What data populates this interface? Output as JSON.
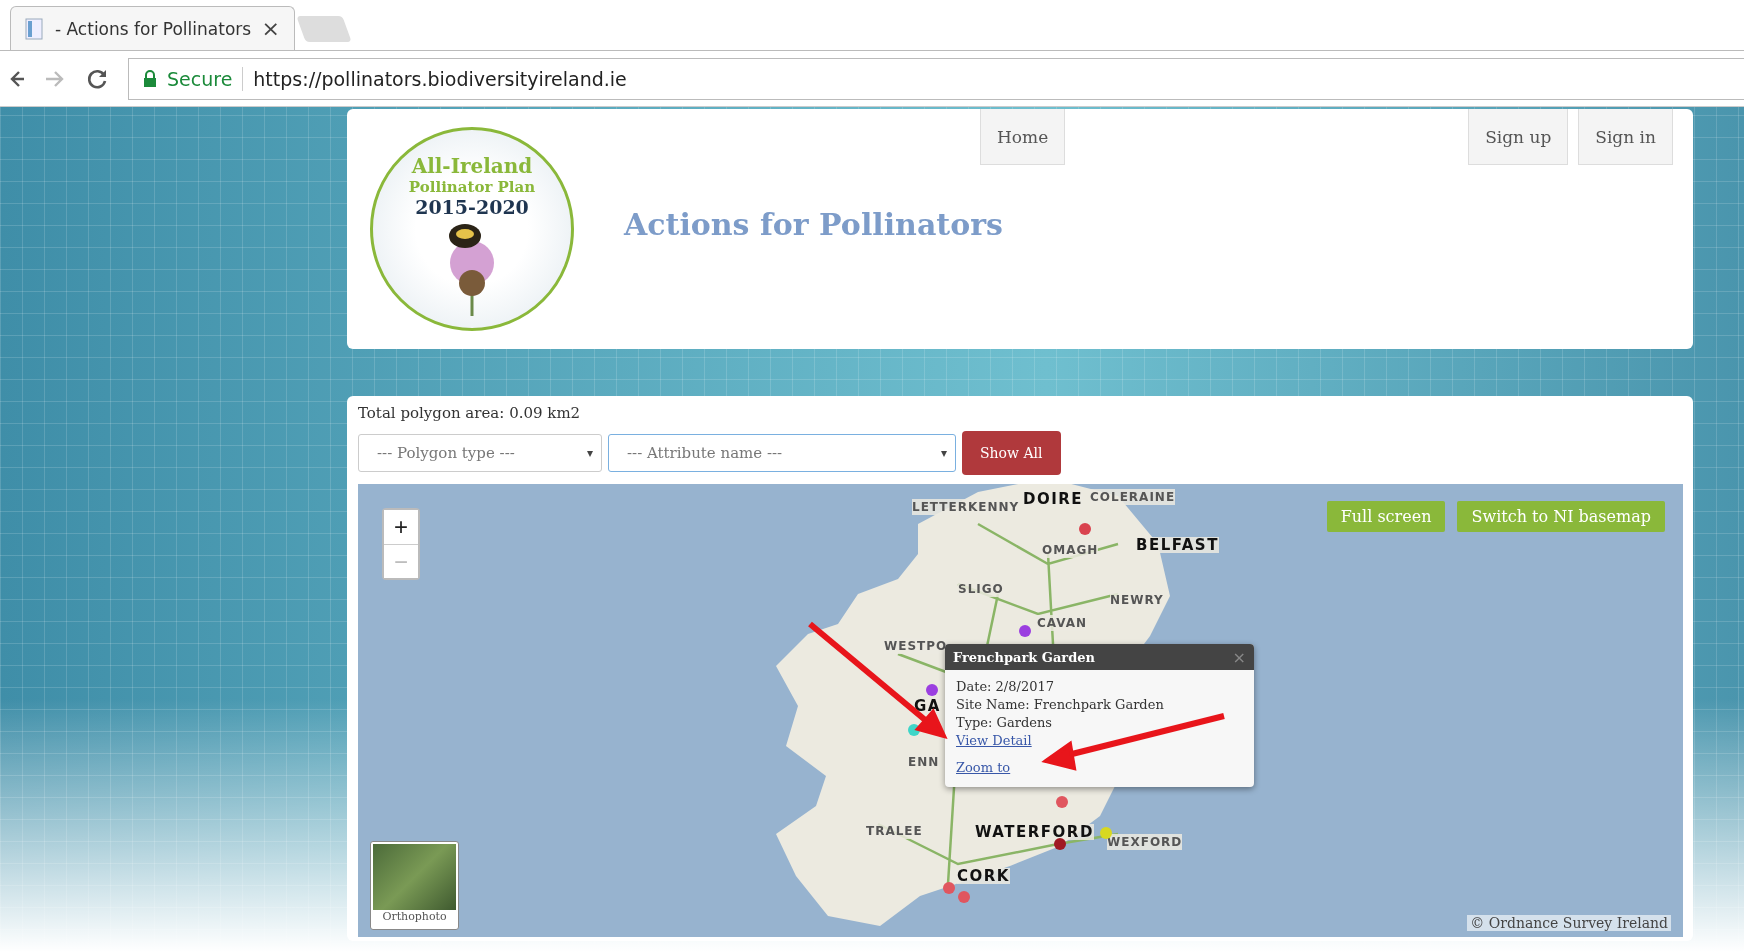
{
  "browser": {
    "tab": {
      "title": "- Actions for Pollinators",
      "close": "×"
    },
    "address": {
      "secure_label": "Secure",
      "url": "https://pollinators.biodiversityireland.ie"
    }
  },
  "header": {
    "logo": {
      "line_1": "All-Ireland",
      "line_2": "Pollinator Plan",
      "line_3": "2015-2020"
    },
    "site_title": "Actions for Pollinators",
    "nav": [
      {
        "label": "Home"
      }
    ],
    "auth": [
      {
        "label": "Sign up"
      },
      {
        "label": "Sign in"
      }
    ]
  },
  "map_panel": {
    "total_area": "Total polygon area: 0.09 km2",
    "filters": [
      {
        "placeholder": "--- Polygon type ---",
        "caret": "▾"
      },
      {
        "placeholder": "--- Attribute name ---",
        "caret": "▾"
      }
    ],
    "show_all": "Show All",
    "map": {
      "zoom_in": "+",
      "zoom_out": "−",
      "buttons": [
        {
          "label": "Full screen"
        },
        {
          "label": "Switch to NI basemap"
        }
      ],
      "labels": [
        {
          "text": "LETTERKENNY",
          "kind": "town"
        },
        {
          "text": "DOIRE",
          "kind": "city"
        },
        {
          "text": "COLERAINE",
          "kind": "town"
        },
        {
          "text": "OMAGH",
          "kind": "town"
        },
        {
          "text": "BELFAST",
          "kind": "city"
        },
        {
          "text": "SLIGO",
          "kind": "town"
        },
        {
          "text": "NEWRY",
          "kind": "town"
        },
        {
          "text": "CAVAN",
          "kind": "town"
        },
        {
          "text": "WESTPO",
          "kind": "town"
        },
        {
          "text": "GA",
          "kind": "city"
        },
        {
          "text": "ENN",
          "kind": "town"
        },
        {
          "text": "TRALEE",
          "kind": "town"
        },
        {
          "text": "WATERFORD",
          "kind": "city"
        },
        {
          "text": "WEXFORD",
          "kind": "town"
        },
        {
          "text": "CORK",
          "kind": "city"
        }
      ],
      "markers": [
        {
          "color": "#9b3fe0"
        },
        {
          "color": "#9b3fe0"
        },
        {
          "color": "#d9434e"
        },
        {
          "color": "#e0565f"
        },
        {
          "color": "#a01a24"
        },
        {
          "color": "#d8d820"
        },
        {
          "color": "#e0565f"
        },
        {
          "color": "#e0565f"
        },
        {
          "color": "#3fd6c8"
        }
      ],
      "popup": {
        "title": "Frenchpark Garden",
        "close": "×",
        "lines": [
          "Date: 2/8/2017",
          "Site Name: Frenchpark Garden",
          "Type: Gardens"
        ],
        "links": [
          "View Detail",
          "Zoom to"
        ]
      },
      "basemap_thumb": "Orthophoto",
      "attribution": "© Ordnance Survey Ireland"
    }
  }
}
